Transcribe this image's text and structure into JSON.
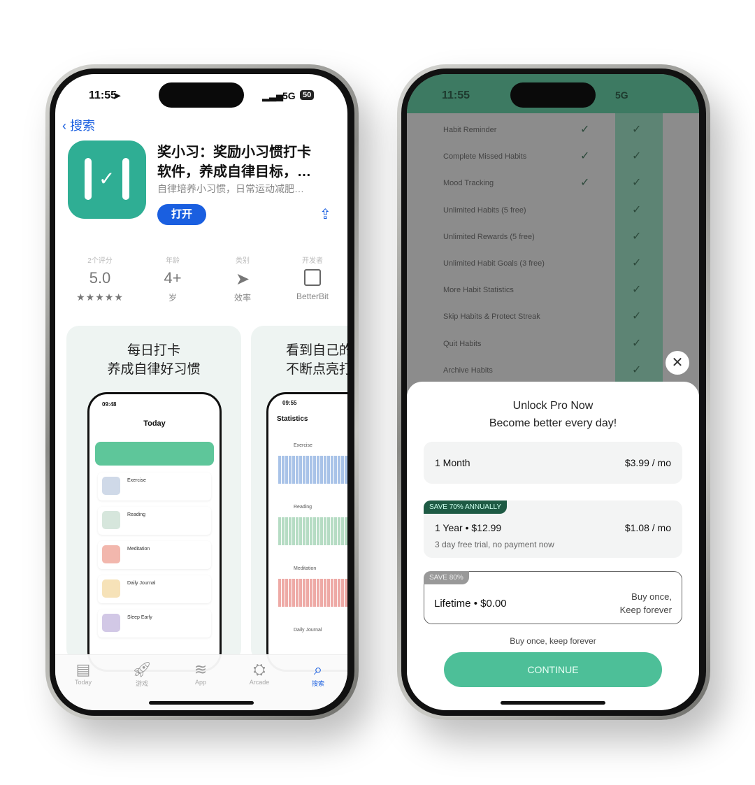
{
  "left_phone": {
    "status": {
      "time": "11:55",
      "network": "5G",
      "battery": "50"
    },
    "nav": {
      "back_label": "搜索"
    },
    "app": {
      "title_line1": "奖小习：奖励小习惯打卡",
      "title_line2": "软件，养成自律目标，…",
      "subtitle": "自律培养小习惯，日常运动减肥…",
      "open_button": "打开",
      "icon_color": "#2fae94"
    },
    "stats": [
      {
        "label": "2个评分",
        "value": "5.0",
        "sub": "★★★★★"
      },
      {
        "label": "年龄",
        "value": "4+",
        "sub": "岁"
      },
      {
        "label": "类别",
        "value": "",
        "sub": "效率"
      },
      {
        "label": "开发者",
        "value": "",
        "sub": "BetterBit"
      }
    ],
    "screenshots": [
      {
        "caption1": "每日打卡",
        "caption2": "养成自律好习惯",
        "time": "09:48",
        "screen_title": "Today",
        "habits": [
          "Exercise",
          "Reading",
          "Meditation",
          "Daily Journal",
          "Sleep Early"
        ]
      },
      {
        "caption1": "看到自己的",
        "caption2": "不断点亮打",
        "time": "09:55",
        "screen_title": "Statistics",
        "habits": [
          "Exercise",
          "Reading",
          "Meditation",
          "Daily Journal"
        ]
      }
    ],
    "tabbar": [
      {
        "label": "Today",
        "icon": "today-icon"
      },
      {
        "label": "游戏",
        "icon": "rocket-icon"
      },
      {
        "label": "App",
        "icon": "layers-icon"
      },
      {
        "label": "Arcade",
        "icon": "joystick-icon"
      },
      {
        "label": "搜索",
        "icon": "search-icon",
        "active": true
      }
    ],
    "accent": "#1a5fe0"
  },
  "right_phone": {
    "status": {
      "time": "11:55",
      "network": "5G"
    },
    "features": [
      {
        "label": "Habit Reminder",
        "free": true
      },
      {
        "label": "Complete Missed Habits",
        "free": true
      },
      {
        "label": "Mood Tracking",
        "free": true
      },
      {
        "label": "Unlimited Habits (5 free)",
        "free": false
      },
      {
        "label": "Unlimited Rewards (5 free)",
        "free": false
      },
      {
        "label": "Unlimited Habit Goals (3 free)",
        "free": false
      },
      {
        "label": "More Habit Statistics",
        "free": false
      },
      {
        "label": "Skip Habits & Protect Streak",
        "free": false
      },
      {
        "label": "Quit Habits",
        "free": false
      },
      {
        "label": "Archive Habits",
        "free": false
      }
    ],
    "paywall": {
      "title": "Unlock Pro Now",
      "subtitle": "Become better every day!",
      "plans": [
        {
          "name": "1 Month",
          "price": "$3.99 / mo"
        },
        {
          "badge": "SAVE 70% ANNUALLY",
          "name": "1 Year • $12.99",
          "price": "$1.08 / mo",
          "note": "3 day free trial, no payment now"
        },
        {
          "badge": "SAVE 80%",
          "name": "Lifetime • $0.00",
          "price_line1": "Buy once,",
          "price_line2": "Keep forever",
          "selected": true
        }
      ],
      "footnote": "Buy once, keep forever",
      "cta": "CONTINUE",
      "accent": "#4dbf98"
    }
  }
}
